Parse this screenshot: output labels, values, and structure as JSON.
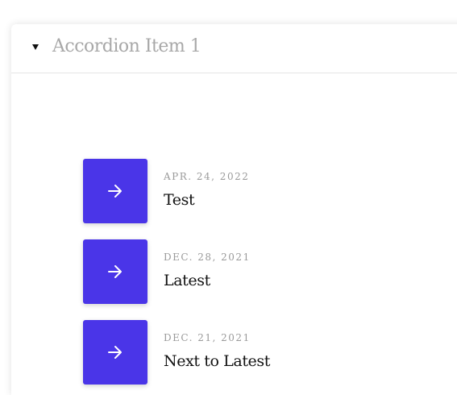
{
  "accordion": {
    "title": "Accordion Item 1",
    "expanded": true,
    "toggle_icon": "caret-down-icon"
  },
  "posts": [
    {
      "date": "APR. 24, 2022",
      "title": "Test",
      "icon": "arrow-right-icon"
    },
    {
      "date": "DEC. 28, 2021",
      "title": "Latest",
      "icon": "arrow-right-icon"
    },
    {
      "date": "DEC. 21, 2021",
      "title": "Next to Latest",
      "icon": "arrow-right-icon"
    }
  ],
  "colors": {
    "accent": "#4a35e8",
    "title_muted": "#a8a8a8",
    "date": "#9a9a9a",
    "post_title": "#111111"
  }
}
